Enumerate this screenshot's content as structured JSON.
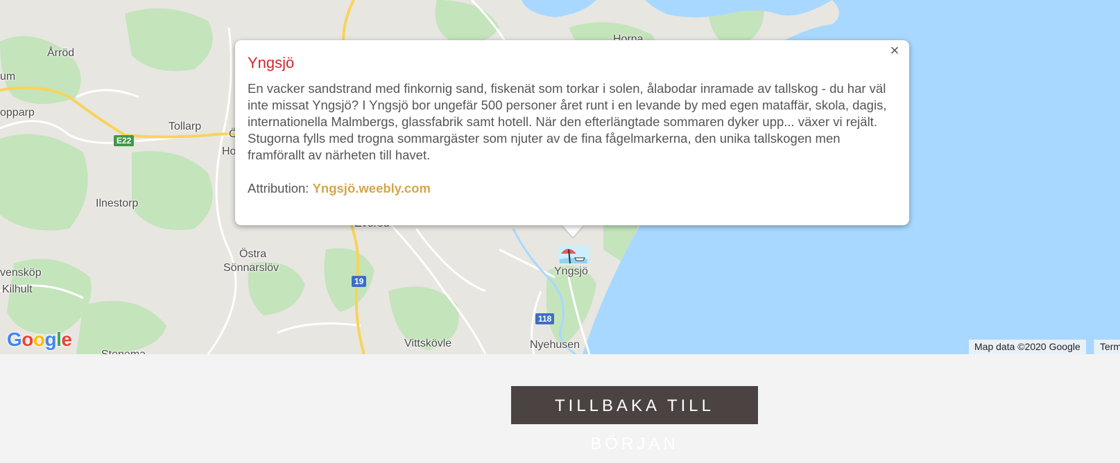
{
  "map": {
    "places": [
      {
        "name": "Årröd"
      },
      {
        "name": "um"
      },
      {
        "name": "opparp"
      },
      {
        "name": "Tollarp"
      },
      {
        "name": "Ö"
      },
      {
        "name": "Ho"
      },
      {
        "name": "Ilnestorp"
      },
      {
        "name": "Everöd"
      },
      {
        "name": "Östra"
      },
      {
        "name": "Sönnarslöv"
      },
      {
        "name": "vensköp"
      },
      {
        "name": "Kilhult"
      },
      {
        "name": "Vittskövle"
      },
      {
        "name": "Nyehusen"
      },
      {
        "name": "Yngsjö"
      },
      {
        "name": "Horna"
      },
      {
        "name": "Stenema"
      }
    ],
    "road_shields": [
      {
        "label": "E22",
        "color": "green"
      },
      {
        "label": "19",
        "color": "blue"
      },
      {
        "label": "118",
        "color": "blue"
      }
    ],
    "google_logo": "Google",
    "map_data": "Map data ©2020 Google",
    "terms": "Term"
  },
  "popup": {
    "title": "Yngsjö",
    "close_icon": "×",
    "description": "En vacker sandstrand med finkornig sand, fiskenät som torkar i solen, ålabodar inramade av tallskog - du har väl inte missat Yngsjö? I Yngsjö bor ungefär 500 personer året runt i en levande by med egen mataffär, skola, dagis, internationella Malmbergs, glassfabrik samt hotell. När den efterlängtade sommaren dyker upp... växer vi rejält. Stugorna fylls med trogna sommargäster som njuter av de fina fågelmarkerna, den unika tallskogen men framförallt av närheten till havet.",
    "attribution_label": "Attribution:",
    "attribution_link": "Yngsjö.weebly.com"
  },
  "marker_icon": "beach-umbrella-icon",
  "back_button": "TILLBAKA TILL BÖRJAN",
  "colors": {
    "water": "#a8d8ff",
    "land": "#e8e6e1",
    "forest": "#c4e4bc",
    "title": "#d4262e",
    "link": "#d4a64a",
    "button": "#4a4342"
  }
}
